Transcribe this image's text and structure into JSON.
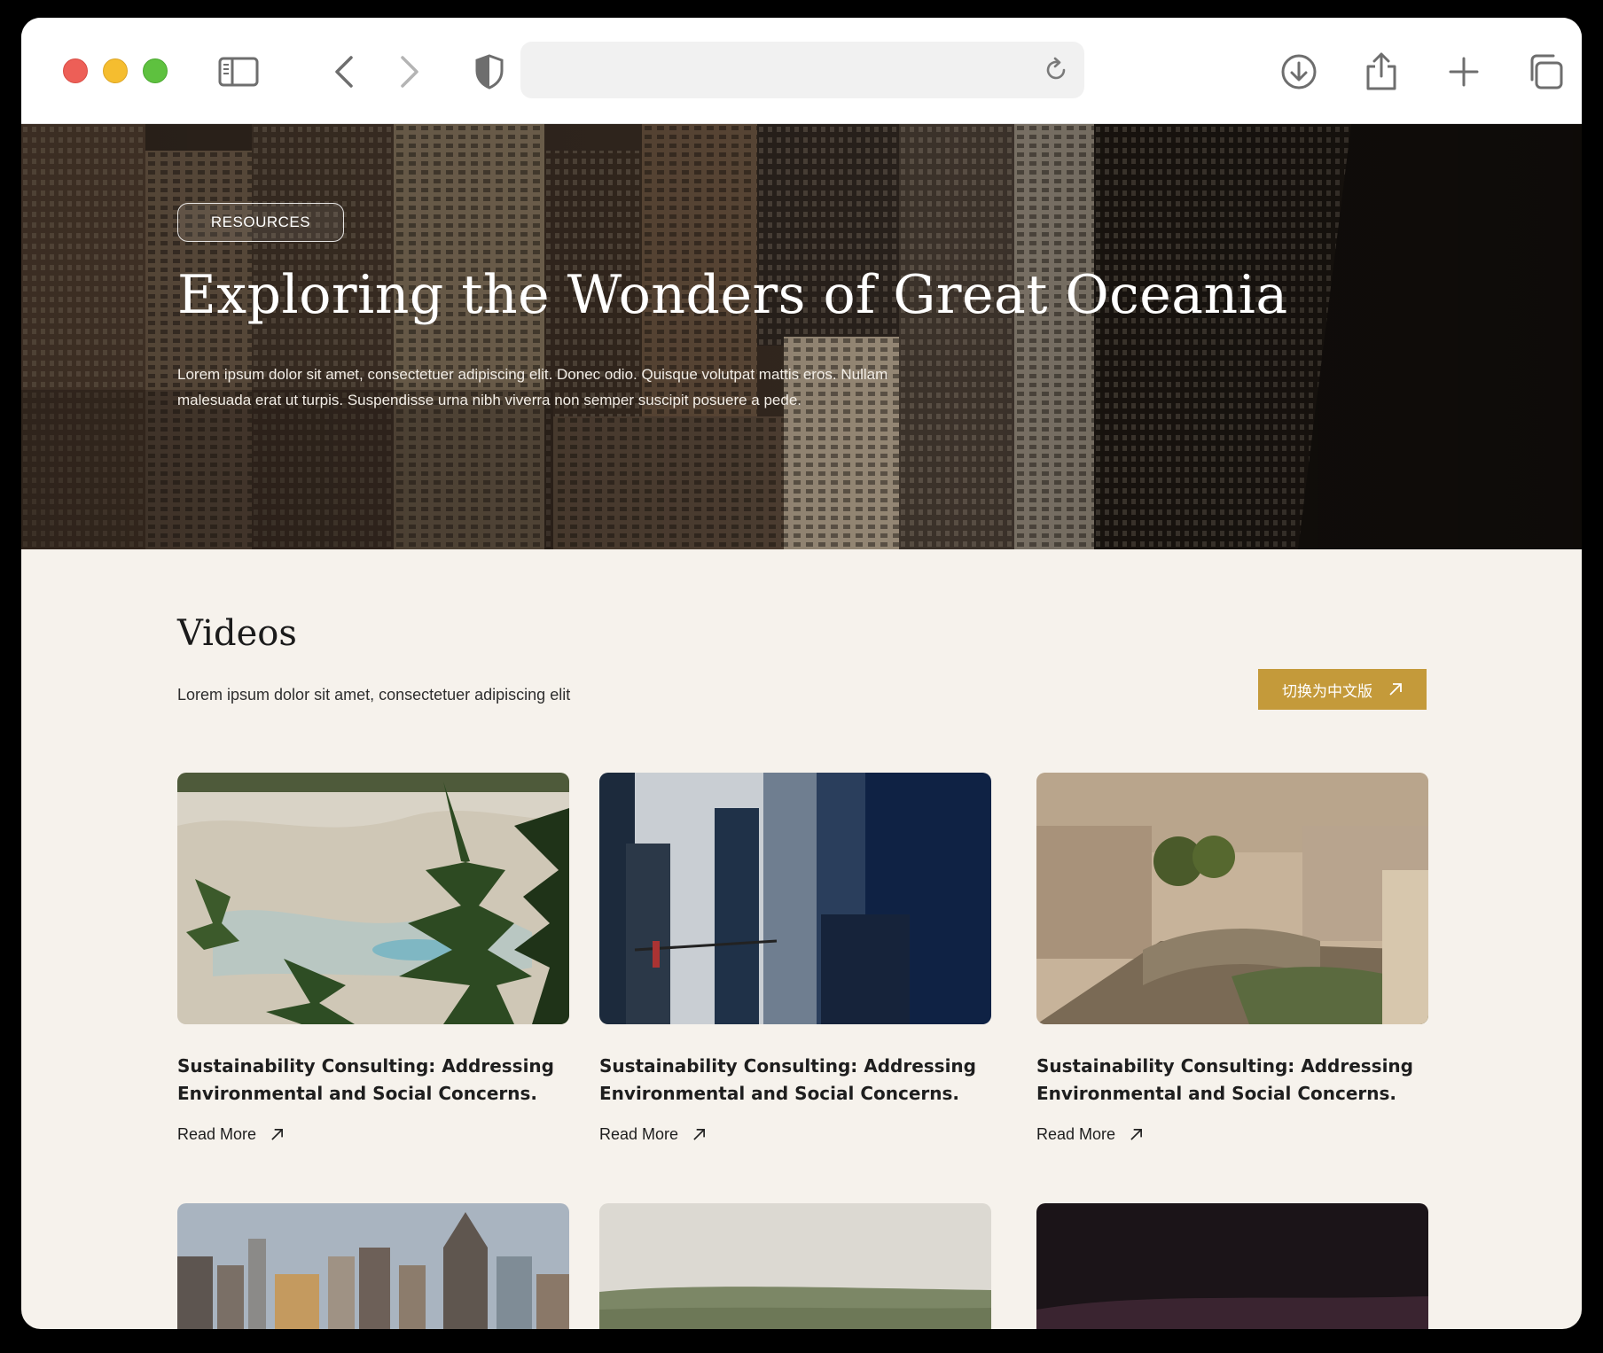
{
  "browser": {
    "address": "",
    "icons": [
      "sidebar-icon",
      "back-icon",
      "forward-icon",
      "shield-icon",
      "reload-icon",
      "download-icon",
      "share-icon",
      "new-tab-icon",
      "tabs-overview-icon"
    ]
  },
  "hero": {
    "badge": "RESOURCES",
    "title": "Exploring the Wonders of Great Oceania",
    "description": "Lorem ipsum dolor sit amet, consectetuer adipiscing elit. Donec odio. Quisque volutpat mattis eros. Nullam malesuada erat ut turpis. Suspendisse urna nibh viverra non semper suscipit posuere a pede."
  },
  "videos": {
    "title": "Videos",
    "subtitle": "Lorem ipsum dolor sit amet, consectetuer adipiscing elit",
    "language_button": "切换为中文版",
    "cards": [
      {
        "title": "Sustainability Consulting: Addressing Environmental and Social Concerns.",
        "link": "Read More"
      },
      {
        "title": "Sustainability Consulting: Addressing Environmental and Social Concerns.",
        "link": "Read More"
      },
      {
        "title": "Sustainability Consulting: Addressing Environmental and Social Concerns.",
        "link": "Read More"
      }
    ]
  },
  "colors": {
    "accent": "#c49a3a",
    "page_background": "#f6f2ec",
    "text": "#1e1e1e"
  }
}
